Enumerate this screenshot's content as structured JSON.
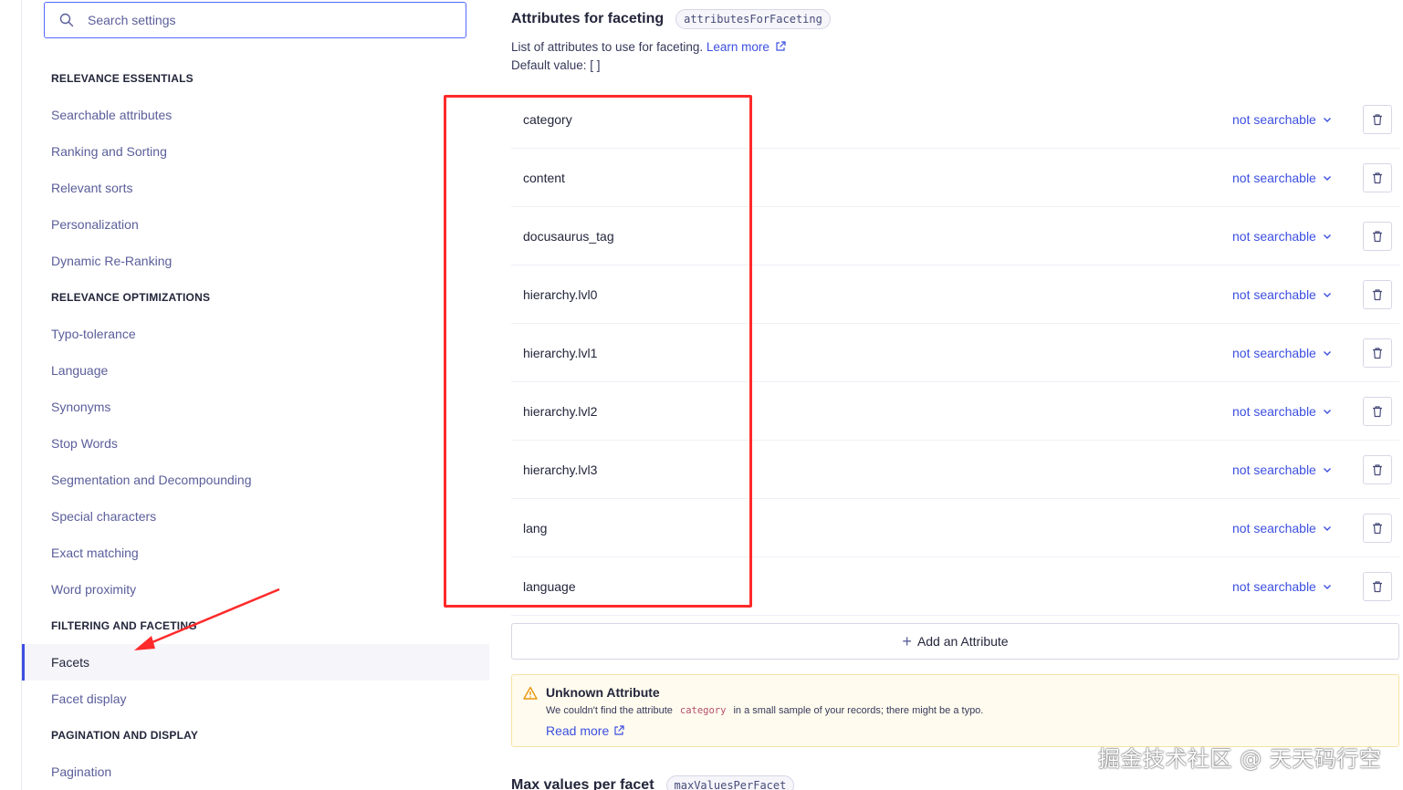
{
  "search": {
    "placeholder": "Search settings"
  },
  "sidebar": {
    "nav": [
      {
        "type": "section",
        "label": "RELEVANCE ESSENTIALS"
      },
      {
        "type": "item",
        "label": "Searchable attributes"
      },
      {
        "type": "item",
        "label": "Ranking and Sorting"
      },
      {
        "type": "item",
        "label": "Relevant sorts"
      },
      {
        "type": "item",
        "label": "Personalization"
      },
      {
        "type": "item",
        "label": "Dynamic Re-Ranking"
      },
      {
        "type": "section",
        "label": "RELEVANCE OPTIMIZATIONS"
      },
      {
        "type": "item",
        "label": "Typo-tolerance"
      },
      {
        "type": "item",
        "label": "Language"
      },
      {
        "type": "item",
        "label": "Synonyms"
      },
      {
        "type": "item",
        "label": "Stop Words"
      },
      {
        "type": "item",
        "label": "Segmentation and Decompounding"
      },
      {
        "type": "item",
        "label": "Special characters"
      },
      {
        "type": "item",
        "label": "Exact matching"
      },
      {
        "type": "item",
        "label": "Word proximity"
      },
      {
        "type": "section",
        "label": "FILTERING AND FACETING"
      },
      {
        "type": "item",
        "label": "Facets",
        "active": true
      },
      {
        "type": "item",
        "label": "Facet display"
      },
      {
        "type": "section",
        "label": "PAGINATION AND DISPLAY"
      },
      {
        "type": "item",
        "label": "Pagination"
      }
    ]
  },
  "main": {
    "title": "Attributes for faceting",
    "code": "attributesForFaceting",
    "description": "List of attributes to use for faceting.",
    "learn_more": "Learn more",
    "default_value": "Default value: [ ]",
    "attributes": [
      {
        "name": "category",
        "mode": "not searchable"
      },
      {
        "name": "content",
        "mode": "not searchable"
      },
      {
        "name": "docusaurus_tag",
        "mode": "not searchable"
      },
      {
        "name": "hierarchy.lvl0",
        "mode": "not searchable"
      },
      {
        "name": "hierarchy.lvl1",
        "mode": "not searchable"
      },
      {
        "name": "hierarchy.lvl2",
        "mode": "not searchable"
      },
      {
        "name": "hierarchy.lvl3",
        "mode": "not searchable"
      },
      {
        "name": "lang",
        "mode": "not searchable"
      },
      {
        "name": "language",
        "mode": "not searchable"
      }
    ],
    "add_attribute": "Add an Attribute",
    "warning": {
      "title": "Unknown Attribute",
      "text_before": "We couldn't find the attribute",
      "code": "category",
      "text_after": "in a small sample of your records; there might be a typo.",
      "link": "Read more"
    },
    "next_title": "Max values per facet",
    "next_code": "maxValuesPerFacet"
  },
  "watermark": "掘金技术社区 @ 天天码行空",
  "colors": {
    "accent": "#3c4fe0",
    "annotation": "#ff2a2a",
    "warning_bg": "#fffbee"
  },
  "icons": {
    "search": "search-icon",
    "chevron": "chevron-down-icon",
    "delete": "trash-icon",
    "external": "external-link-icon",
    "warning": "warning-triangle-icon"
  }
}
